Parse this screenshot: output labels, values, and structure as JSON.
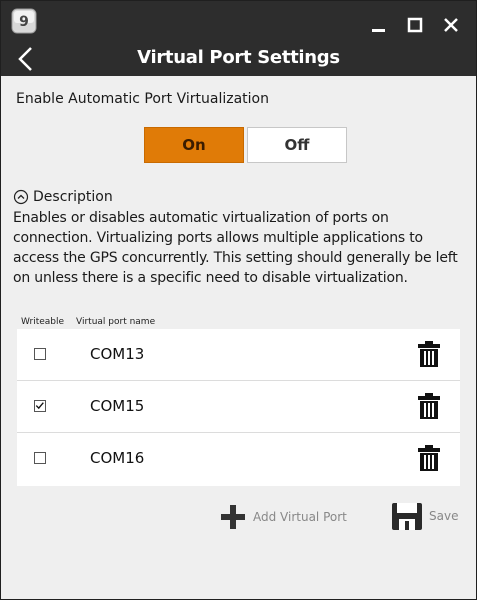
{
  "window": {
    "badge_number": "9",
    "title": "Virtual Port Settings"
  },
  "auto_virtualization": {
    "label": "Enable Automatic Port Virtualization",
    "on_label": "On",
    "off_label": "Off",
    "selected": "On",
    "accent_color": "#e07b07"
  },
  "description": {
    "title": "Description",
    "text": "Enables or disables automatic virtualization of ports on connection. Virtualizing ports allows multiple applications to access the GPS concurrently. This setting should generally be left on unless there is a specific need to disable virtualization."
  },
  "ports_table": {
    "columns": [
      "Writeable",
      "Virtual port name"
    ],
    "rows": [
      {
        "writeable": false,
        "name": "COM13"
      },
      {
        "writeable": true,
        "name": "COM15"
      },
      {
        "writeable": false,
        "name": "COM16"
      }
    ]
  },
  "actions": {
    "add_label": "Add Virtual Port",
    "save_label": "Save"
  }
}
